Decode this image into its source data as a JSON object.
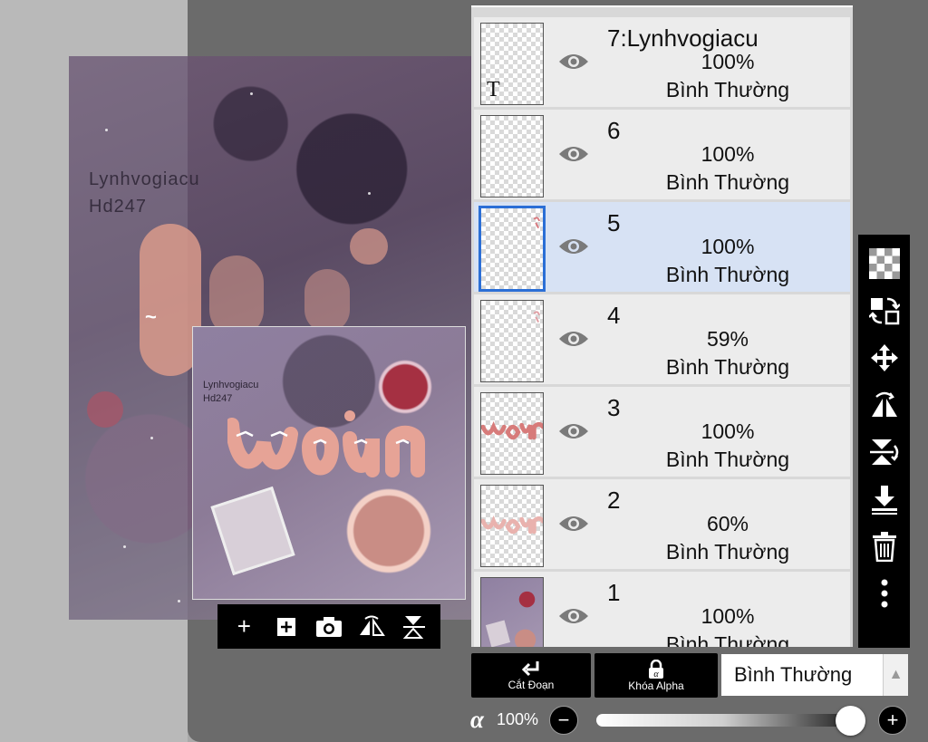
{
  "canvas": {
    "text_line1": "Lynhvogiacu",
    "text_line2": "Hd247"
  },
  "preview": {
    "text_line1": "Lynhvogiacu",
    "text_line2": "Hd247"
  },
  "preview_toolbar": {
    "icons": [
      "plus-icon",
      "add-layer-icon",
      "camera-icon",
      "flip-horizontal-icon",
      "flip-vertical-icon"
    ]
  },
  "layers": [
    {
      "name": "7:Lynhvogiacu",
      "opacity": "100%",
      "mode": "Bình Thường",
      "glyph": "T"
    },
    {
      "name": "6",
      "opacity": "100%",
      "mode": "Bình Thường"
    },
    {
      "name": "5",
      "opacity": "100%",
      "mode": "Bình Thường",
      "selected": true
    },
    {
      "name": "4",
      "opacity": "59%",
      "mode": "Bình Thường"
    },
    {
      "name": "3",
      "opacity": "100%",
      "mode": "Bình Thường"
    },
    {
      "name": "2",
      "opacity": "60%",
      "mode": "Bình Thường"
    },
    {
      "name": "1",
      "opacity": "100%",
      "mode": "Bình Thường"
    }
  ],
  "tool_strip": {
    "icons": [
      "transparency-icon",
      "layer-transfer-icon",
      "move-icon",
      "flip-horizontal-icon",
      "flip-vertical-icon",
      "merge-down-icon",
      "trash-icon",
      "more-icon"
    ]
  },
  "bottom": {
    "clip_label": "Cắt Đoạn",
    "alpha_lock_label": "Khóa Alpha",
    "blend_mode": "Bình Thường",
    "alpha_symbol": "α",
    "alpha_value": "100%",
    "opacity_level": 1.0
  },
  "colors": {
    "selected_row": "#d7e2f4",
    "selected_border": "#2b6fd6",
    "accent_pink": "#d99a8b"
  }
}
